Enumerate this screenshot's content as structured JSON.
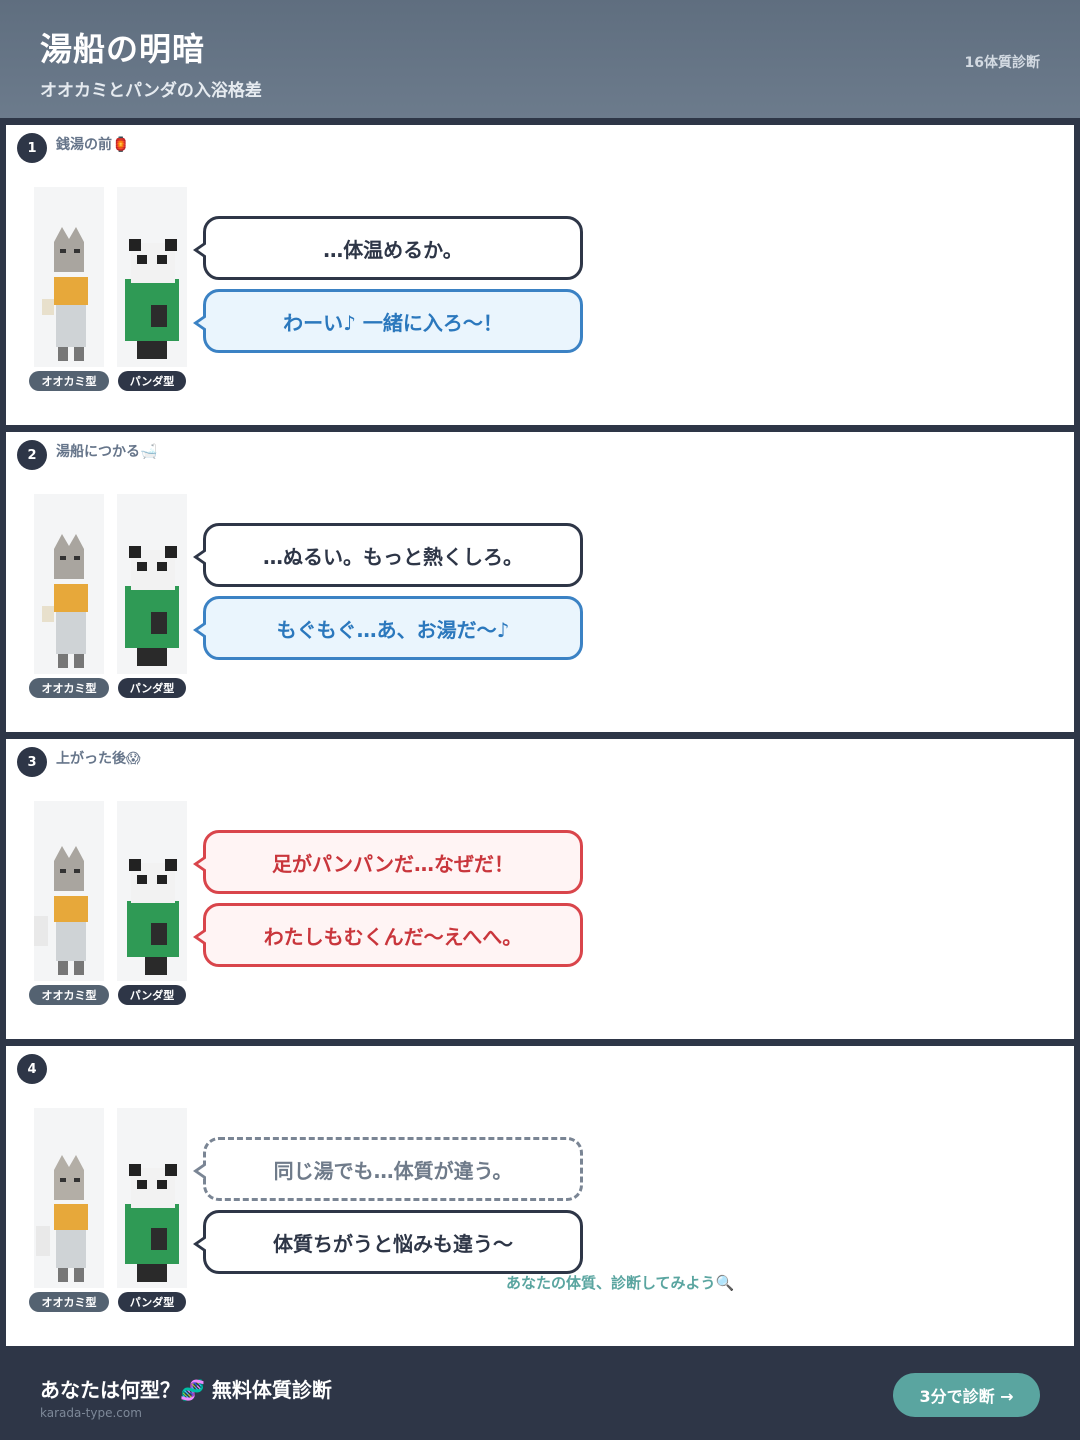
{
  "header": {
    "title": "湯船の明暗",
    "subtitle": "オオカミとパンダの入浴格差",
    "tag": "16体質診断"
  },
  "character_labels": {
    "wolf": "オオカミ型",
    "panda": "パンダ型"
  },
  "panels": [
    {
      "number": "1",
      "scene": "銭湯の前🏮",
      "bubbles": [
        "…体温めるか。",
        "わーい♪ 一緒に入ろ〜！"
      ]
    },
    {
      "number": "2",
      "scene": "湯船につかる🛁",
      "bubbles": [
        "…ぬるい。もっと熱くしろ。",
        "もぐもぐ…あ、お湯だ〜♪"
      ]
    },
    {
      "number": "3",
      "scene": "上がった後😱",
      "bubbles": [
        "足がパンパンだ…なぜだ！",
        "わたしもむくんだ〜えへへ。"
      ]
    },
    {
      "number": "4",
      "scene": "",
      "bubbles": [
        "同じ湯でも…体質が違う。",
        "体質ちがうと悩みも違う〜"
      ],
      "hint": "あなたの体質、診断してみよう🔍"
    }
  ],
  "footer": {
    "title": "あなたは何型？🧬 無料体質診断",
    "url": "karada-type.com",
    "button": "3分で診断 →"
  },
  "colors": {
    "header_bg": "#66768a",
    "dark": "#2e3647",
    "blue": "#3b82c4",
    "red": "#d9454b",
    "teal": "#5aa5a0"
  }
}
